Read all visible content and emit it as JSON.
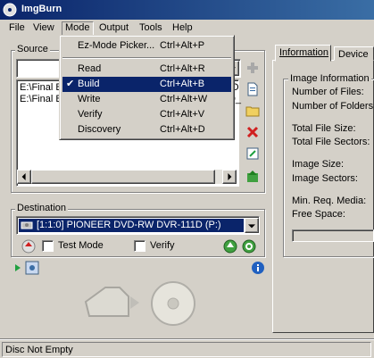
{
  "window": {
    "title": "ImgBurn"
  },
  "menubar": [
    {
      "label": "File"
    },
    {
      "label": "View"
    },
    {
      "label": "Mode"
    },
    {
      "label": "Output"
    },
    {
      "label": "Tools"
    },
    {
      "label": "Help"
    }
  ],
  "mode_menu": {
    "items": [
      {
        "label": "Ez-Mode Picker...",
        "shortcut": "Ctrl+Alt+P"
      },
      {
        "label": "Read",
        "shortcut": "Ctrl+Alt+R"
      },
      {
        "label": "Build",
        "shortcut": "Ctrl+Alt+B",
        "checked": true
      },
      {
        "label": "Write",
        "shortcut": "Ctrl+Alt+W"
      },
      {
        "label": "Verify",
        "shortcut": "Ctrl+Alt+V"
      },
      {
        "label": "Discovery",
        "shortcut": "Ctrl+Alt+D"
      }
    ],
    "check_mark": "✔"
  },
  "source": {
    "label": "Source",
    "input_value": "",
    "files": [
      {
        "name": "E:\\Final B",
        "tail": "DIO"
      },
      {
        "name": "E:\\Final B",
        "tail": "EO_"
      }
    ]
  },
  "side_icons": [
    "add-icon",
    "add-file-icon",
    "add-folder-icon",
    "delete-icon",
    "edit-icon",
    "export-icon"
  ],
  "destination": {
    "label": "Destination",
    "drive": "[1:1:0] PIONEER DVD-RW  DVR-111D (P:)",
    "test_mode_label": "Test Mode",
    "verify_label": "Verify"
  },
  "tabs": [
    {
      "label": "Information",
      "active": true
    },
    {
      "label": "Device",
      "active": false
    }
  ],
  "information": {
    "group_label": "Image Information",
    "fields": [
      "Number of Files:",
      "Number of Folders:",
      "Total File Size:",
      "Total File Sectors:",
      "Image Size:",
      "Image Sectors:",
      "Min. Req. Media:",
      "Free Space:"
    ]
  },
  "status": {
    "text": "Disc Not Empty"
  },
  "colors": {
    "title_gradient_start": "#0a246a",
    "title_gradient_end": "#3a6ea5",
    "highlight": "#0a246a",
    "face": "#d4d0c8"
  }
}
